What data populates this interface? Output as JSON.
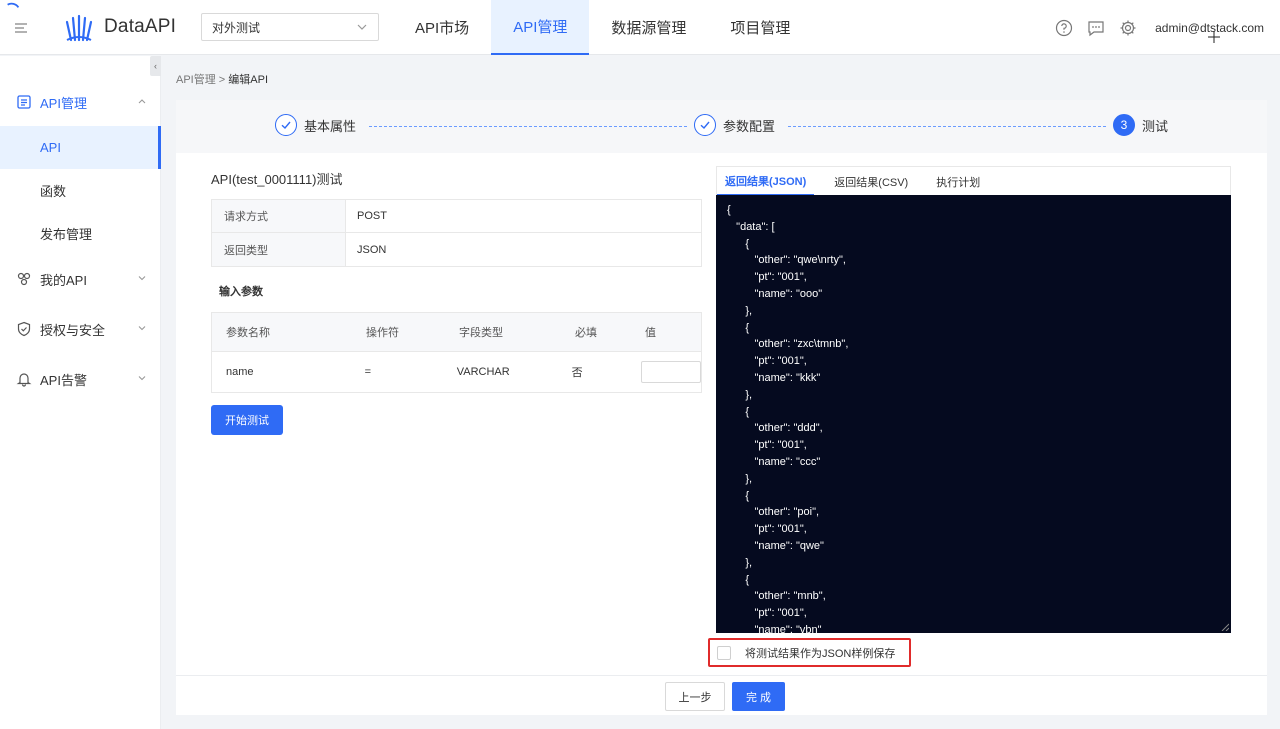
{
  "header": {
    "logo_text": "DataAPI",
    "project_select": "对外测试",
    "nav": [
      "API市场",
      "API管理",
      "数据源管理",
      "项目管理"
    ],
    "active_nav": 1,
    "user": "admin@dtstack.com"
  },
  "sidebar": {
    "collapse_glyph": "‹",
    "groups": [
      {
        "label": "API管理",
        "icon": "api-list-icon",
        "open": true
      },
      {
        "label": "我的API",
        "icon": "my-api-icon"
      },
      {
        "label": "授权与安全",
        "icon": "shield-icon"
      },
      {
        "label": "API告警",
        "icon": "bell-icon"
      }
    ],
    "sub_items": [
      "API",
      "函数",
      "发布管理"
    ],
    "active_sub": 0
  },
  "breadcrumb": {
    "parent": "API管理",
    "separator": ">",
    "current": "编辑API"
  },
  "steps": [
    {
      "label": "基本属性",
      "state": "done"
    },
    {
      "label": "参数配置",
      "state": "done"
    },
    {
      "label": "测试",
      "state": "current",
      "number": "3"
    }
  ],
  "test": {
    "title": "API(test_0001111)测试",
    "info": [
      {
        "label": "请求方式",
        "value": "POST"
      },
      {
        "label": "返回类型",
        "value": "JSON"
      }
    ],
    "input_params_title": "输入参数",
    "param_headers": [
      "参数名称",
      "操作符",
      "字段类型",
      "必填",
      "值"
    ],
    "params": [
      {
        "name": "name",
        "operator": "=",
        "type": "VARCHAR",
        "required": "否",
        "value": ""
      }
    ],
    "start_button": "开始测试"
  },
  "result": {
    "tabs": [
      "返回结果(JSON)",
      "返回结果(CSV)",
      "执行计划"
    ],
    "active_tab": 0,
    "json_text": "{\n   \"data\": [\n      {\n         \"other\": \"qwe\\nrty\",\n         \"pt\": \"001\",\n         \"name\": \"ooo\"\n      },\n      {\n         \"other\": \"zxc\\tmnb\",\n         \"pt\": \"001\",\n         \"name\": \"kkk\"\n      },\n      {\n         \"other\": \"ddd\",\n         \"pt\": \"001\",\n         \"name\": \"ccc\"\n      },\n      {\n         \"other\": \"poi\",\n         \"pt\": \"001\",\n         \"name\": \"qwe\"\n      },\n      {\n         \"other\": \"mnb\",\n         \"pt\": \"001\",\n         \"name\": \"vbn\"",
    "save_checkbox_label": "将测试结果作为JSON样例保存",
    "save_checked": false
  },
  "footer": {
    "prev": "上一步",
    "done": "完 成"
  },
  "colors": {
    "accent": "#2f6bf5",
    "highlight_border": "#e02b2b",
    "code_bg": "#050a1f"
  }
}
